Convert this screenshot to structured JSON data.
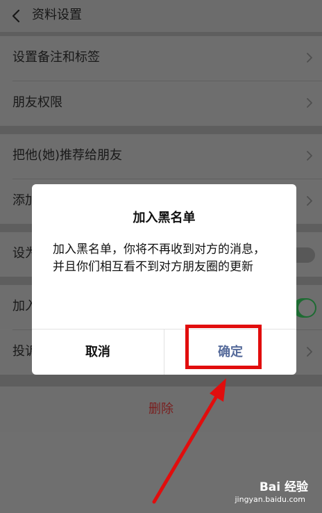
{
  "header": {
    "title": "资料设置",
    "back_icon": "chevron-left-icon"
  },
  "menu": {
    "items": [
      {
        "label": "设置备注和标签",
        "control": "chevron"
      },
      {
        "label": "朋友权限",
        "control": "chevron"
      },
      {
        "label": "把他(她)推荐给朋友",
        "control": "chevron"
      },
      {
        "label": "添加到桌面",
        "visible_label": "添加",
        "control": "chevron"
      },
      {
        "label": "设为星标朋友",
        "visible_label": "设为",
        "control": "toggle",
        "state": "off"
      },
      {
        "label": "加入黑名单",
        "visible_label": "加入",
        "control": "toggle",
        "state": "on"
      },
      {
        "label": "投诉",
        "visible_label": "投诉",
        "control": "chevron"
      }
    ],
    "delete_label": "删除"
  },
  "dialog": {
    "title": "加入黑名单",
    "message": "加入黑名单，你将不再收到对方的消息，并且你们相互看不到对方朋友圈的更新",
    "cancel_label": "取消",
    "confirm_label": "确定"
  },
  "annotation": {
    "highlight_color": "#e10d0d",
    "arrow_color": "#e10d0d"
  },
  "watermark": {
    "brand": "Bai  经验",
    "url": "jingyan.baidu.com"
  },
  "colors": {
    "confirm_text": "#556a9a",
    "toggle_on": "#1d6b32",
    "delete_text": "#7a1f1f"
  }
}
